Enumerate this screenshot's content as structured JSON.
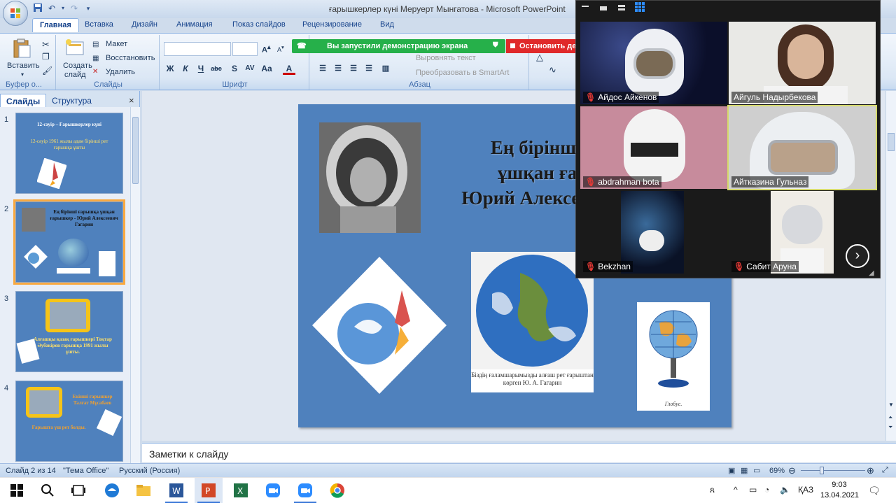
{
  "window": {
    "title": "ғарышкерлер күні Меруерт Мынгатова - Microsoft PowerPoint"
  },
  "ribbon_tabs": [
    "Главная",
    "Вставка",
    "Дизайн",
    "Анимация",
    "Показ слайдов",
    "Рецензирование",
    "Вид"
  ],
  "ribbon": {
    "clipboard": {
      "paste_label": "Вставить",
      "group_label": "Буфер о..."
    },
    "slides": {
      "new_slide_line1": "Создать",
      "new_slide_line2": "слайд",
      "layout": "Макет",
      "reset": "Восстановить",
      "delete": "Удалить",
      "group_label": "Слайды"
    },
    "font": {
      "group_label": "Шрифт"
    },
    "paragraph": {
      "align_text": "Выровнять текст",
      "smartart": "Преобразовать в SmartArt",
      "group_label": "Абзац"
    }
  },
  "screen_share": {
    "status": "Вы запустили демонстрацию экрана",
    "stop": "Остановить демонстрацию"
  },
  "left_panel": {
    "tabs": [
      "Слайды",
      "Структура"
    ],
    "close": "×",
    "thumbnails": [
      {
        "num": "1",
        "title": "12-сәуір – Ғарышкерлер күні",
        "subtitle": "12-сәуір 1961 жылы адам бірінші рет ғарышқа ұшты"
      },
      {
        "num": "2",
        "title": "Ең бірінші ғарышқа ұшқан ғарышкер - Юрий Алексеевич Гагарин"
      },
      {
        "num": "3",
        "title": "Алғашқы қазақ ғарышкері Тоқтар Әубәкіров ғарышқа 1991 жылы ұшты."
      },
      {
        "num": "4",
        "title": "Екінші ғарышкер Талғат Мұсабаев",
        "subtitle": "Ғарышта үш рет болды."
      }
    ]
  },
  "slide": {
    "title_lines": [
      "Ең бірінші ғарышқа",
      "ұшқан ғарышкер -",
      "Юрий Алексеевич Гагарин"
    ],
    "earth_caption": "Біздің ғаламшарымызды алғаш рет ғарыштан көрген Ю. А. Гагарин",
    "globe_caption": "Глобус."
  },
  "notes": {
    "placeholder": "Заметки к слайду"
  },
  "status_bar": {
    "slide_info": "Слайд 2 из 14",
    "theme": "\"Тема Office\"",
    "language": "Русский (Россия)",
    "zoom": "69%"
  },
  "taskbar": {
    "time": "9:03",
    "date": "13.04.2021",
    "lang": "ҚАЗ"
  },
  "zoom_participants": [
    {
      "name": "Айдос Айкенов",
      "muted": true
    },
    {
      "name": "Айгуль Надырбекова",
      "muted": false
    },
    {
      "name": "abdrahman bota",
      "muted": true
    },
    {
      "name": "Айтказина Гульназ",
      "muted": false
    },
    {
      "name": "Bekzhan",
      "muted": true
    },
    {
      "name": "Сабит Аруна",
      "muted": true
    }
  ],
  "colors": {
    "slide_bg": "#4f81bd",
    "share_green": "#26b04a",
    "share_red": "#e0292a",
    "accent": "#f8a941"
  }
}
